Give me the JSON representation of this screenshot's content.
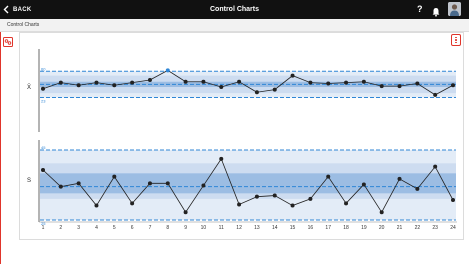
{
  "header": {
    "back_label": "BACK",
    "title": "Control Charts",
    "help_label": "?"
  },
  "breadcrumb": {
    "label": "Control Charts"
  },
  "colors": {
    "header_bg": "#111111",
    "accent": "#e0352b",
    "limit_line": "#2f86d6",
    "band_outer": "#e3ecf7",
    "band_mid": "#cddcf0",
    "band_inner": "#9cbde3",
    "series": "#222222",
    "highlight_point": "#2f86d6"
  },
  "chart_data": [
    {
      "type": "line",
      "ylabel": "X̄",
      "x": [
        1,
        2,
        3,
        4,
        5,
        6,
        7,
        8,
        9,
        10,
        11,
        12,
        13,
        14,
        15,
        16,
        17,
        18,
        19,
        20,
        21,
        22,
        23,
        24
      ],
      "values": [
        22,
        29,
        26,
        29,
        26,
        29,
        32,
        43,
        30,
        30,
        24,
        30,
        18,
        21,
        37,
        29,
        28,
        29,
        30,
        25,
        25,
        28,
        15,
        26
      ],
      "highlight_index": 7,
      "ylim": [
        0,
        48
      ],
      "limits": {
        "ucl": 42,
        "lcl": 12,
        "upper_inner": 37,
        "lower_inner": 17,
        "center_upper": 30,
        "center": 27,
        "center_lower": 24
      },
      "limit_labels": {
        "ucl": "60",
        "lcl": "23"
      }
    },
    {
      "type": "line",
      "ylabel": "S",
      "x": [
        1,
        2,
        3,
        4,
        5,
        6,
        7,
        8,
        9,
        10,
        11,
        12,
        13,
        14,
        15,
        16,
        17,
        18,
        19,
        20,
        21,
        22,
        23,
        24
      ],
      "values": [
        45,
        30,
        33,
        13,
        39,
        15,
        33,
        33,
        7,
        31,
        55,
        14,
        21,
        22,
        13,
        19,
        39,
        15,
        32,
        7,
        37,
        28,
        48,
        18
      ],
      "ylim": [
        0,
        72
      ],
      "limits": {
        "ucl": 63,
        "lcl": 0,
        "upper_inner": 51,
        "lower_inner": 19,
        "center_upper": 42,
        "center": 30,
        "center_lower": 24
      },
      "limit_labels": {
        "ucl": "45",
        "lcl": "25"
      }
    }
  ]
}
